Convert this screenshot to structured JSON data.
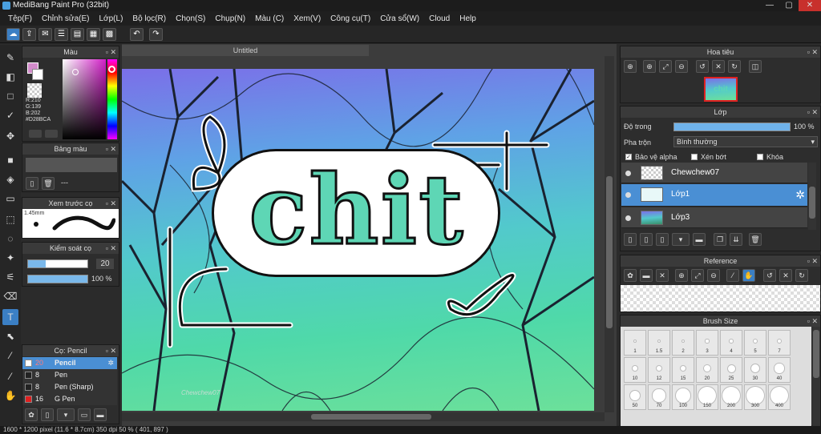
{
  "window": {
    "title": "MediBang Paint Pro (32bit)",
    "controls": [
      "—",
      "▢",
      "✕"
    ]
  },
  "menu": [
    "Tệp(F)",
    "Chỉnh sửa(E)",
    "Lớp(L)",
    "Bộ lọc(R)",
    "Chọn(S)",
    "Chụp(N)",
    "Màu (C)",
    "Xem(V)",
    "Công cụ(T)",
    "Cửa sổ(W)",
    "Cloud",
    "Help"
  ],
  "toolbar": {
    "icons": [
      "cloud-icon",
      "share-icon",
      "comment-icon",
      "chat-icon",
      "page-icon",
      "layout-icon",
      "grid-icon",
      "undo-icon",
      "redo-icon"
    ]
  },
  "color_panel": {
    "title": "Màu",
    "r": "R:210",
    "g": "G:139",
    "b": "B:202",
    "hex": "#D28BCA",
    "fg": "#D28BCA",
    "bg": "#ffffff"
  },
  "palette_panel": {
    "title": "Bảng màu",
    "dashes": "---"
  },
  "preview_panel": {
    "title": "Xem trước cọ",
    "size": "1.45mm"
  },
  "brush_control": {
    "title": "Kiểm soát cọ",
    "size_val": "20",
    "size_fill": 0.3,
    "opacity_val": "100 %",
    "opacity_fill": 1.0
  },
  "brush_list": {
    "title": "Cọ: Pencil",
    "items": [
      {
        "size": "20",
        "name": "Pencil",
        "color": "#ffffff",
        "selected": true
      },
      {
        "size": "8",
        "name": "Pen",
        "color": "#222222",
        "selected": false
      },
      {
        "size": "8",
        "name": "Pen (Sharp)",
        "color": "#222222",
        "selected": false
      },
      {
        "size": "16",
        "name": "G Pen",
        "color": "#e02020",
        "selected": false
      }
    ]
  },
  "document": {
    "tab": "Untitled",
    "artwork_text": "chit",
    "signature": "Chewchew07"
  },
  "navigator": {
    "title": "Hoa tiêu",
    "thumb_text": "chit"
  },
  "layers": {
    "title": "Lớp",
    "opacity_label": "Độ trong",
    "opacity_value": "100 %",
    "opacity_fill": 1.0,
    "blend_label": "Pha trộn",
    "blend_value": "Bình thường",
    "protect_alpha": "Bảo vệ alpha",
    "clipping": "Xén bớt",
    "lock": "Khóa",
    "items": [
      {
        "name": "Chewchew07",
        "selected": false
      },
      {
        "name": "Lớp1",
        "selected": true
      },
      {
        "name": "Lớp3",
        "selected": false
      }
    ]
  },
  "reference": {
    "title": "Reference"
  },
  "brush_size": {
    "title": "Brush Size",
    "sizes": [
      "1",
      "1.5",
      "2",
      "3",
      "4",
      "5",
      "7",
      "10",
      "12",
      "15",
      "20",
      "25",
      "30",
      "40",
      "50",
      "70",
      "100",
      "150",
      "200",
      "300",
      "400"
    ]
  },
  "status": "1600 * 1200 pixel  (11.6 * 8.7cm)  350 dpi  50 %  ( 401, 897 )"
}
